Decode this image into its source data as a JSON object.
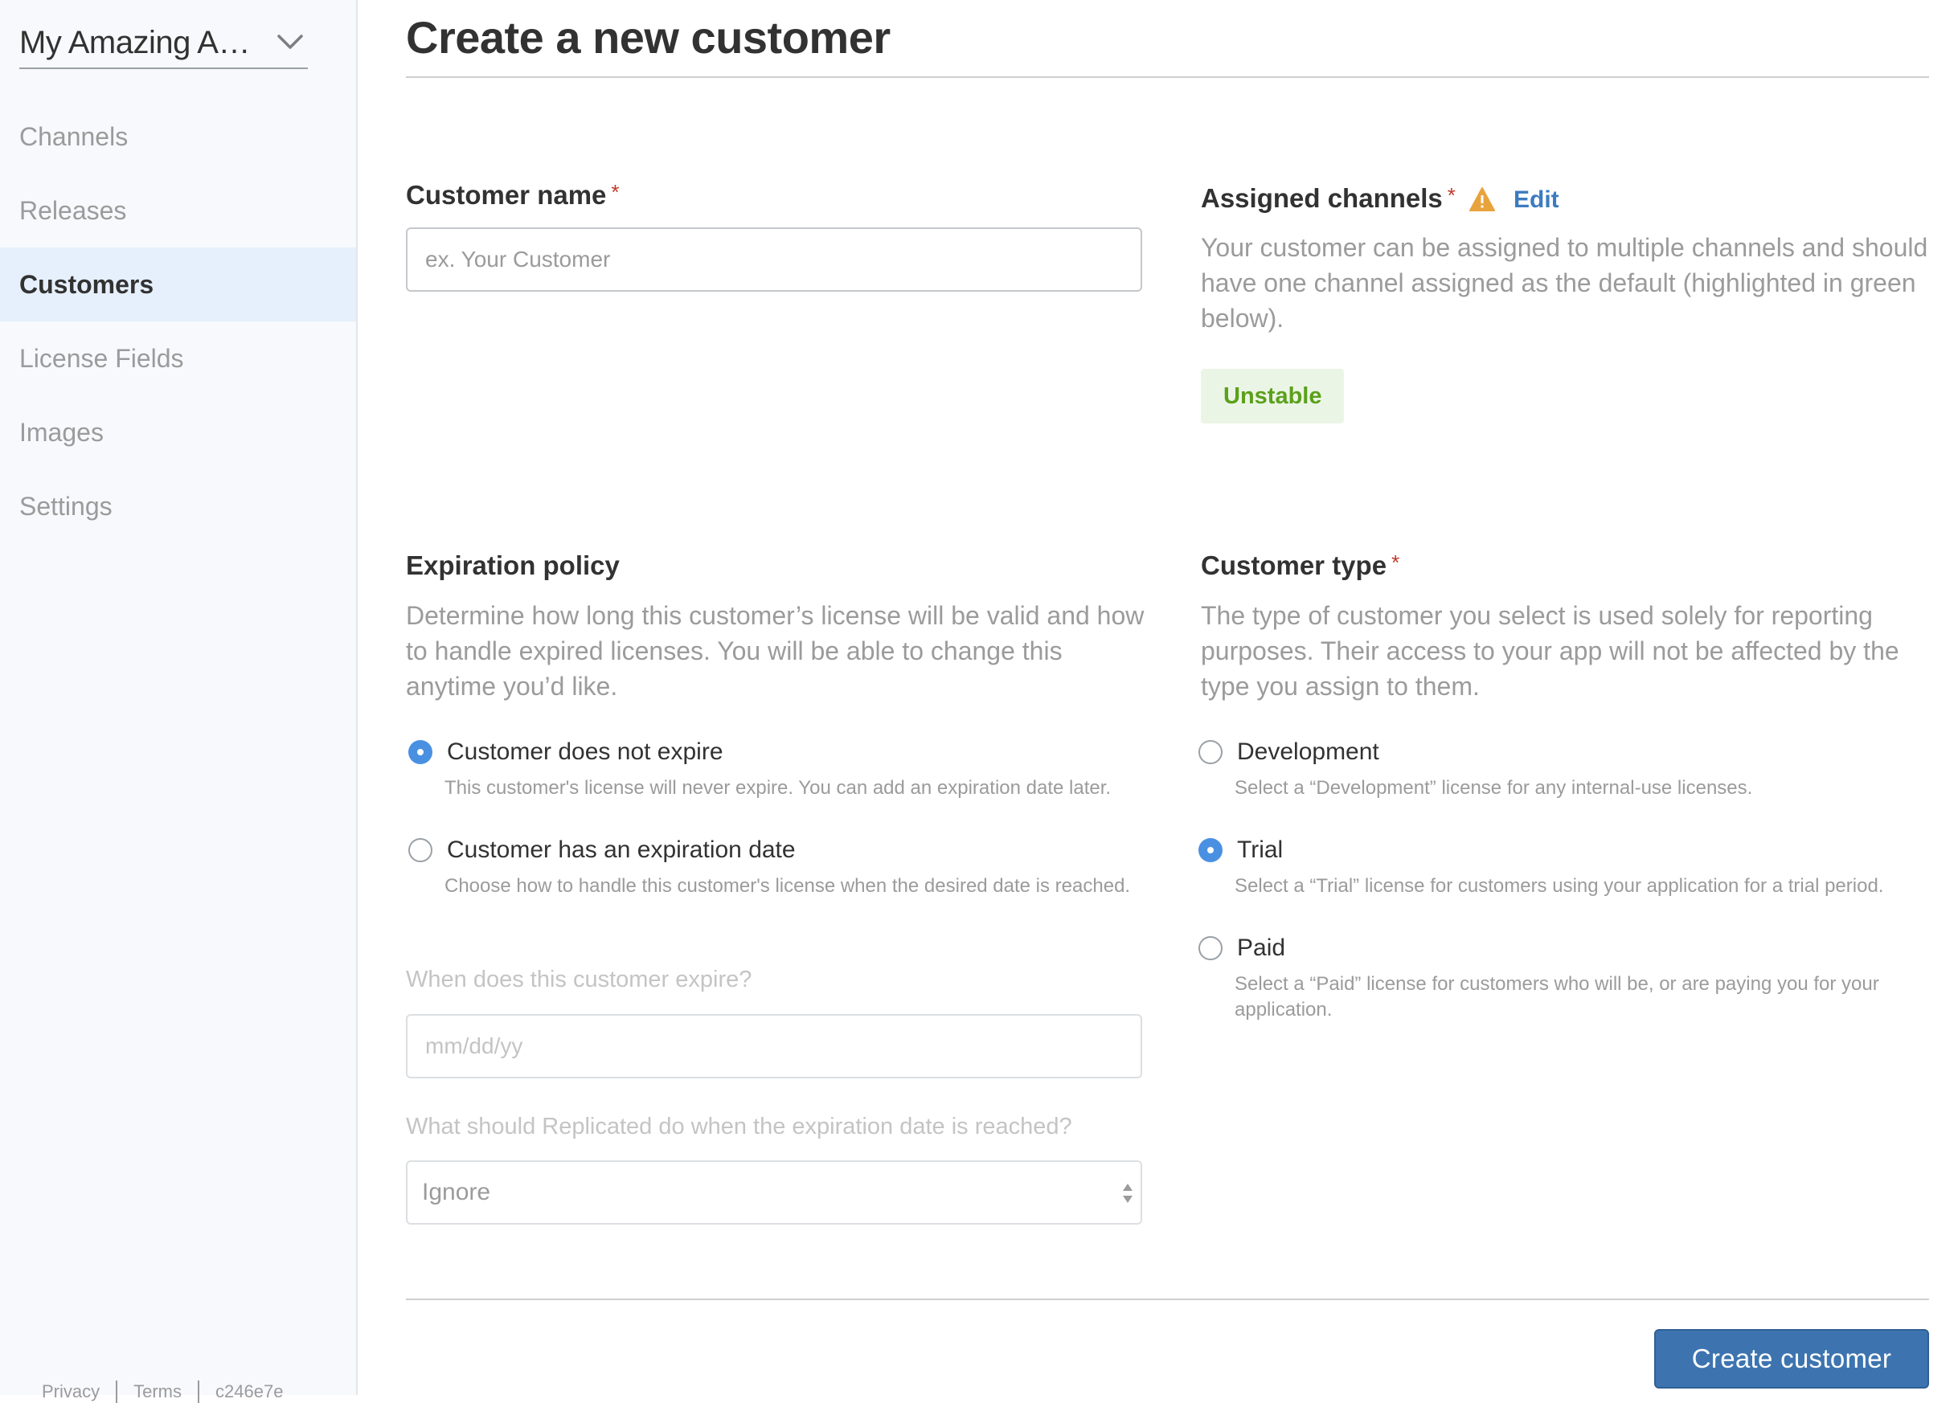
{
  "sidebar": {
    "app_switcher": {
      "label": "My Amazing Ap…"
    },
    "items": [
      {
        "label": "Channels",
        "active": false
      },
      {
        "label": "Releases",
        "active": false
      },
      {
        "label": "Customers",
        "active": true
      },
      {
        "label": "License Fields",
        "active": false
      },
      {
        "label": "Images",
        "active": false
      },
      {
        "label": "Settings",
        "active": false
      }
    ],
    "footer": {
      "privacy": "Privacy",
      "terms": "Terms",
      "version": "c246e7e"
    }
  },
  "page": {
    "title": "Create a new customer"
  },
  "customer_name": {
    "label": "Customer name",
    "required_marker": "*",
    "placeholder": "ex. Your Customer",
    "value": ""
  },
  "assigned_channels": {
    "label": "Assigned channels",
    "required_marker": "*",
    "warning_icon": "warning-triangle-icon",
    "edit_label": "Edit",
    "description": "Your customer can be assigned to multiple channels and should have one channel assigned as the default (highlighted in green below).",
    "channels": [
      {
        "name": "Unstable",
        "default": true
      }
    ]
  },
  "expiration_policy": {
    "label": "Expiration policy",
    "description": "Determine how long this customer’s license will be valid and how to handle expired licenses. You will be able to change this anytime you’d like.",
    "options": [
      {
        "label": "Customer does not expire",
        "help": "This customer's license will never expire. You can add an expiration date later.",
        "selected": true
      },
      {
        "label": "Customer has an expiration date",
        "help": "Choose how to handle this customer's license when the desired date is reached.",
        "selected": false
      }
    ],
    "expire_date": {
      "label": "When does this customer expire?",
      "placeholder": "mm/dd/yy"
    },
    "expire_action": {
      "label": "What should Replicated do when the expiration date is reached?",
      "selected": "Ignore"
    }
  },
  "customer_type": {
    "label": "Customer type",
    "required_marker": "*",
    "description": "The type of customer you select is used solely for reporting purposes. Their access to your app will not be affected by the type you assign to them.",
    "options": [
      {
        "label": "Development",
        "help": "Select a “Development” license for any internal-use licenses.",
        "selected": false
      },
      {
        "label": "Trial",
        "help": "Select a “Trial” license for customers using your application for a trial period.",
        "selected": true
      },
      {
        "label": "Paid",
        "help": "Select a “Paid” license for customers who will be, or are paying you for your application.",
        "selected": false
      }
    ]
  },
  "actions": {
    "create_label": "Create customer"
  },
  "colors": {
    "accent": "#4a90e2",
    "primary_button": "#3d74b0",
    "channel_chip_bg": "#ebf5e6",
    "channel_chip_text": "#5ba01a",
    "warning": "#e8a33d",
    "required": "#c0392b",
    "link": "#3c7bbf"
  }
}
